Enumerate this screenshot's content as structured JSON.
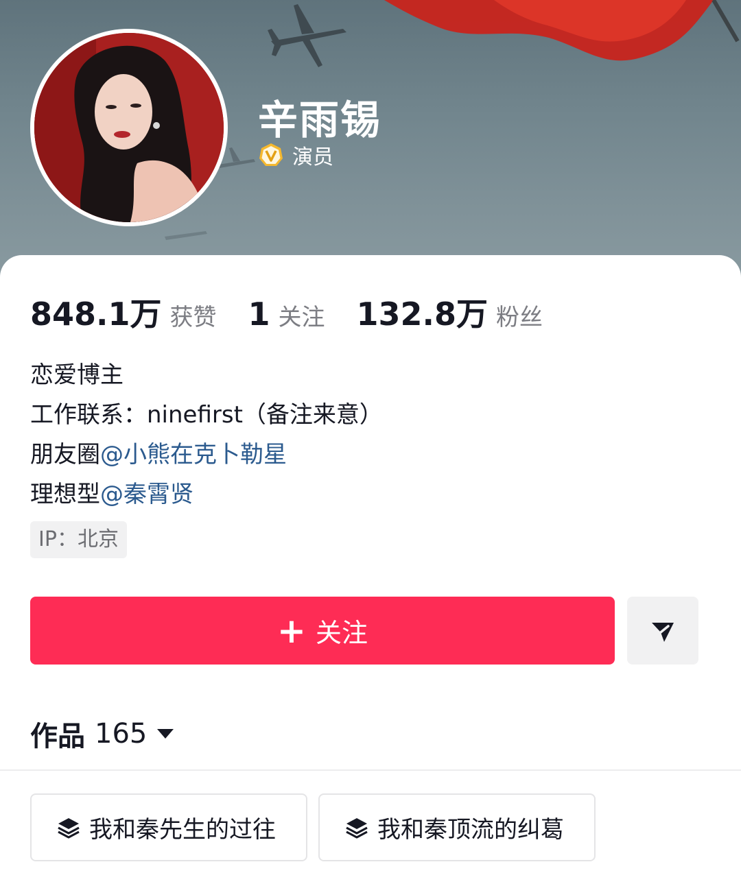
{
  "profile": {
    "name": "辛雨锡",
    "verified_icon": "verified-v-badge-icon",
    "role": "演员"
  },
  "stats": [
    {
      "value": "848.1万",
      "label": "获赞"
    },
    {
      "value": "1",
      "label": "关注"
    },
    {
      "value": "132.8万",
      "label": "粉丝"
    }
  ],
  "bio": {
    "line1": "恋爱博主",
    "line2": "工作联系：ninefirst（备注来意）",
    "line3_prefix": "朋友圈",
    "line3_mention": "@小熊在克卜勒星",
    "line4_prefix": "理想型",
    "line4_mention": "@秦霄贤"
  },
  "ip_location": "IP：北京",
  "actions": {
    "follow_label": "关注",
    "follow_icon": "plus-icon",
    "share_icon": "send-arrow-icon"
  },
  "works": {
    "label": "作品",
    "count": "165",
    "caret_icon": "caret-down-icon"
  },
  "collections": [
    {
      "icon": "layers-icon",
      "label": "我和秦先生的过往"
    },
    {
      "icon": "layers-icon",
      "label": "我和秦顶流的纠葛"
    }
  ],
  "colors": {
    "accent": "#fe2c55",
    "mention": "#2b5a8e",
    "text_primary": "#161823",
    "text_secondary": "#7c7d83",
    "verified_gold": "#f5b82e"
  }
}
